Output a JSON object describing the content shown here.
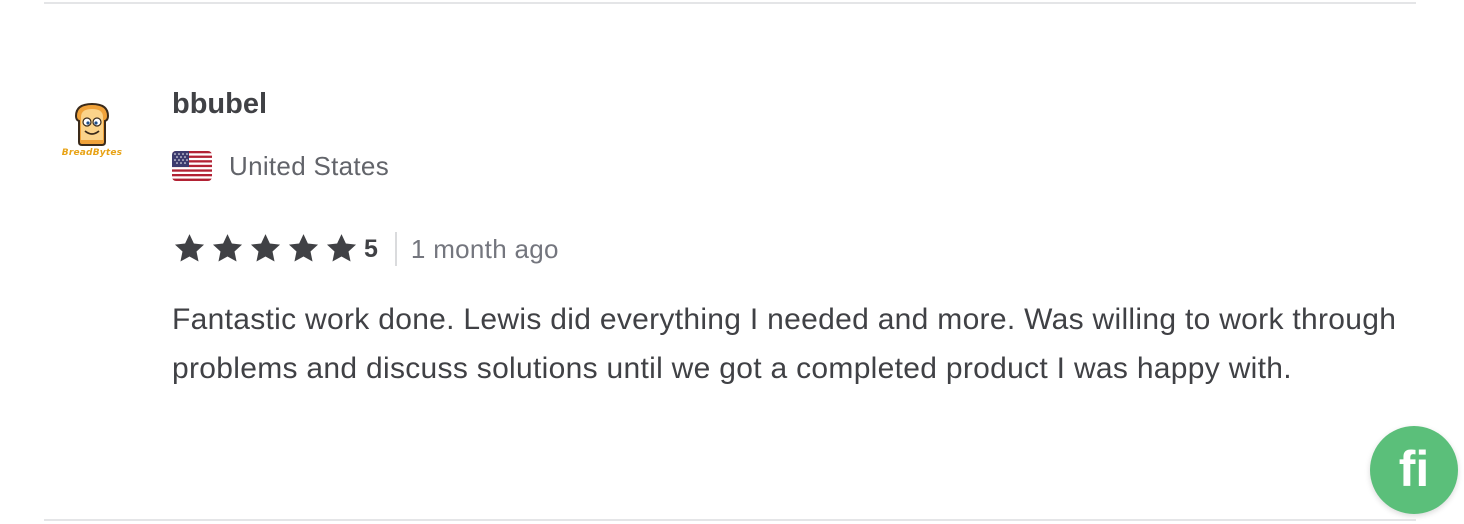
{
  "review": {
    "avatar": {
      "icon": "breadbytes-logo-icon",
      "brand_text": "BreadBytes"
    },
    "username": "bbubel",
    "country": {
      "flag_icon": "us-flag-icon",
      "name": "United States"
    },
    "rating": {
      "stars": 5,
      "max_stars": 5,
      "value": "5",
      "star_color": "#404145"
    },
    "time_ago": "1 month ago",
    "text": "Fantastic work done. Lewis did everything I needed and more. Was willing to work through problems and discuss solutions until we got a completed product I was happy with."
  },
  "chat_fab": {
    "label": "fi",
    "icon": "fiverr-logo-icon",
    "color": "#5bbf7a"
  }
}
